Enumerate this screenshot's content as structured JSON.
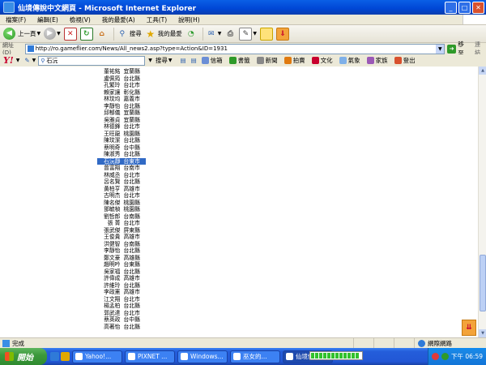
{
  "window": {
    "title": "仙境傳說中文網頁 - Microsoft Internet Explorer",
    "minimize": "_",
    "maximize": "□",
    "close": "✕"
  },
  "menu": [
    "檔案(F)",
    "編輯(E)",
    "檢視(V)",
    "我的最愛(A)",
    "工具(T)",
    "說明(H)"
  ],
  "toolbar": {
    "back_label": "上一頁",
    "search_label": "搜尋",
    "favorites_label": "我的最愛"
  },
  "address": {
    "label": "網址(D)",
    "url": "http://ro.gameflier.com/News/All_news2.asp?type=Action&ID=1931",
    "go_label": "移至",
    "links_label": "連結"
  },
  "yahoo_toolbar": {
    "logo": "Y!",
    "search_value": "石沅",
    "search_button": "搜尋",
    "items": [
      "信箱",
      "書籤",
      "新聞",
      "拍賣",
      "文化",
      "氣象",
      "家族",
      "登出"
    ]
  },
  "list": [
    {
      "name": "董祐銘",
      "city": "宜蘭縣"
    },
    {
      "name": "盧佩筠",
      "city": "台北縣"
    },
    {
      "name": "孔繁玲",
      "city": "台北市"
    },
    {
      "name": "賴家讓",
      "city": "彰化縣"
    },
    {
      "name": "林玟均",
      "city": "嘉義市"
    },
    {
      "name": "李靜怡",
      "city": "台北縣"
    },
    {
      "name": "邱郁儀",
      "city": "宜蘭縣"
    },
    {
      "name": "吳雅貞",
      "city": "宜蘭縣"
    },
    {
      "name": "林德鋒",
      "city": "台北市"
    },
    {
      "name": "王旺龍",
      "city": "桃園縣"
    },
    {
      "name": "陳玟潔",
      "city": "台北縣"
    },
    {
      "name": "蔡明奇",
      "city": "台中縣"
    },
    {
      "name": "陳淑秀",
      "city": "台北縣"
    },
    {
      "name": "石沅靜",
      "city": "台東市"
    },
    {
      "name": "曾富翔",
      "city": "台南市"
    },
    {
      "name": "林威丞",
      "city": "台北市"
    },
    {
      "name": "呂名賢",
      "city": "台北縣"
    },
    {
      "name": "黃柏亨",
      "city": "高雄市"
    },
    {
      "name": "古明杰",
      "city": "台北市"
    },
    {
      "name": "陳名傑",
      "city": "桃園縣"
    },
    {
      "name": "鄧毓楨",
      "city": "桃園縣"
    },
    {
      "name": "劉哲郎",
      "city": "台南縣"
    },
    {
      "name": "張 菁",
      "city": "台北市"
    },
    {
      "name": "張武傑",
      "city": "屏東縣"
    },
    {
      "name": "王俊貴",
      "city": "高雄市"
    },
    {
      "name": "洪健智",
      "city": "台南縣"
    },
    {
      "name": "李靜怡",
      "city": "台北縣"
    },
    {
      "name": "鄭文豪",
      "city": "高雄縣"
    },
    {
      "name": "趙明吟",
      "city": "台東縣"
    },
    {
      "name": "吳家福",
      "city": "台北縣"
    },
    {
      "name": "許偉成",
      "city": "高雄市"
    },
    {
      "name": "許維玲",
      "city": "台北縣"
    },
    {
      "name": "李政憲",
      "city": "高雄市"
    },
    {
      "name": "江文翔",
      "city": "台北市"
    },
    {
      "name": "楊孟柏",
      "city": "台北縣"
    },
    {
      "name": "郭武達",
      "city": "台北市"
    },
    {
      "name": "蔡英政",
      "city": "台中縣"
    },
    {
      "name": "高著怡",
      "city": "台北縣"
    }
  ],
  "selected_index": 13,
  "status": {
    "text": "完成",
    "zone": "網際網路"
  },
  "taskbar": {
    "start_label": "開始",
    "tasks": [
      "Yahoo!...",
      "PIXNET ...",
      "Windows...",
      "巫女的...",
      "仙境傳..."
    ],
    "active_task": 4,
    "clock": "下午 06:59"
  }
}
